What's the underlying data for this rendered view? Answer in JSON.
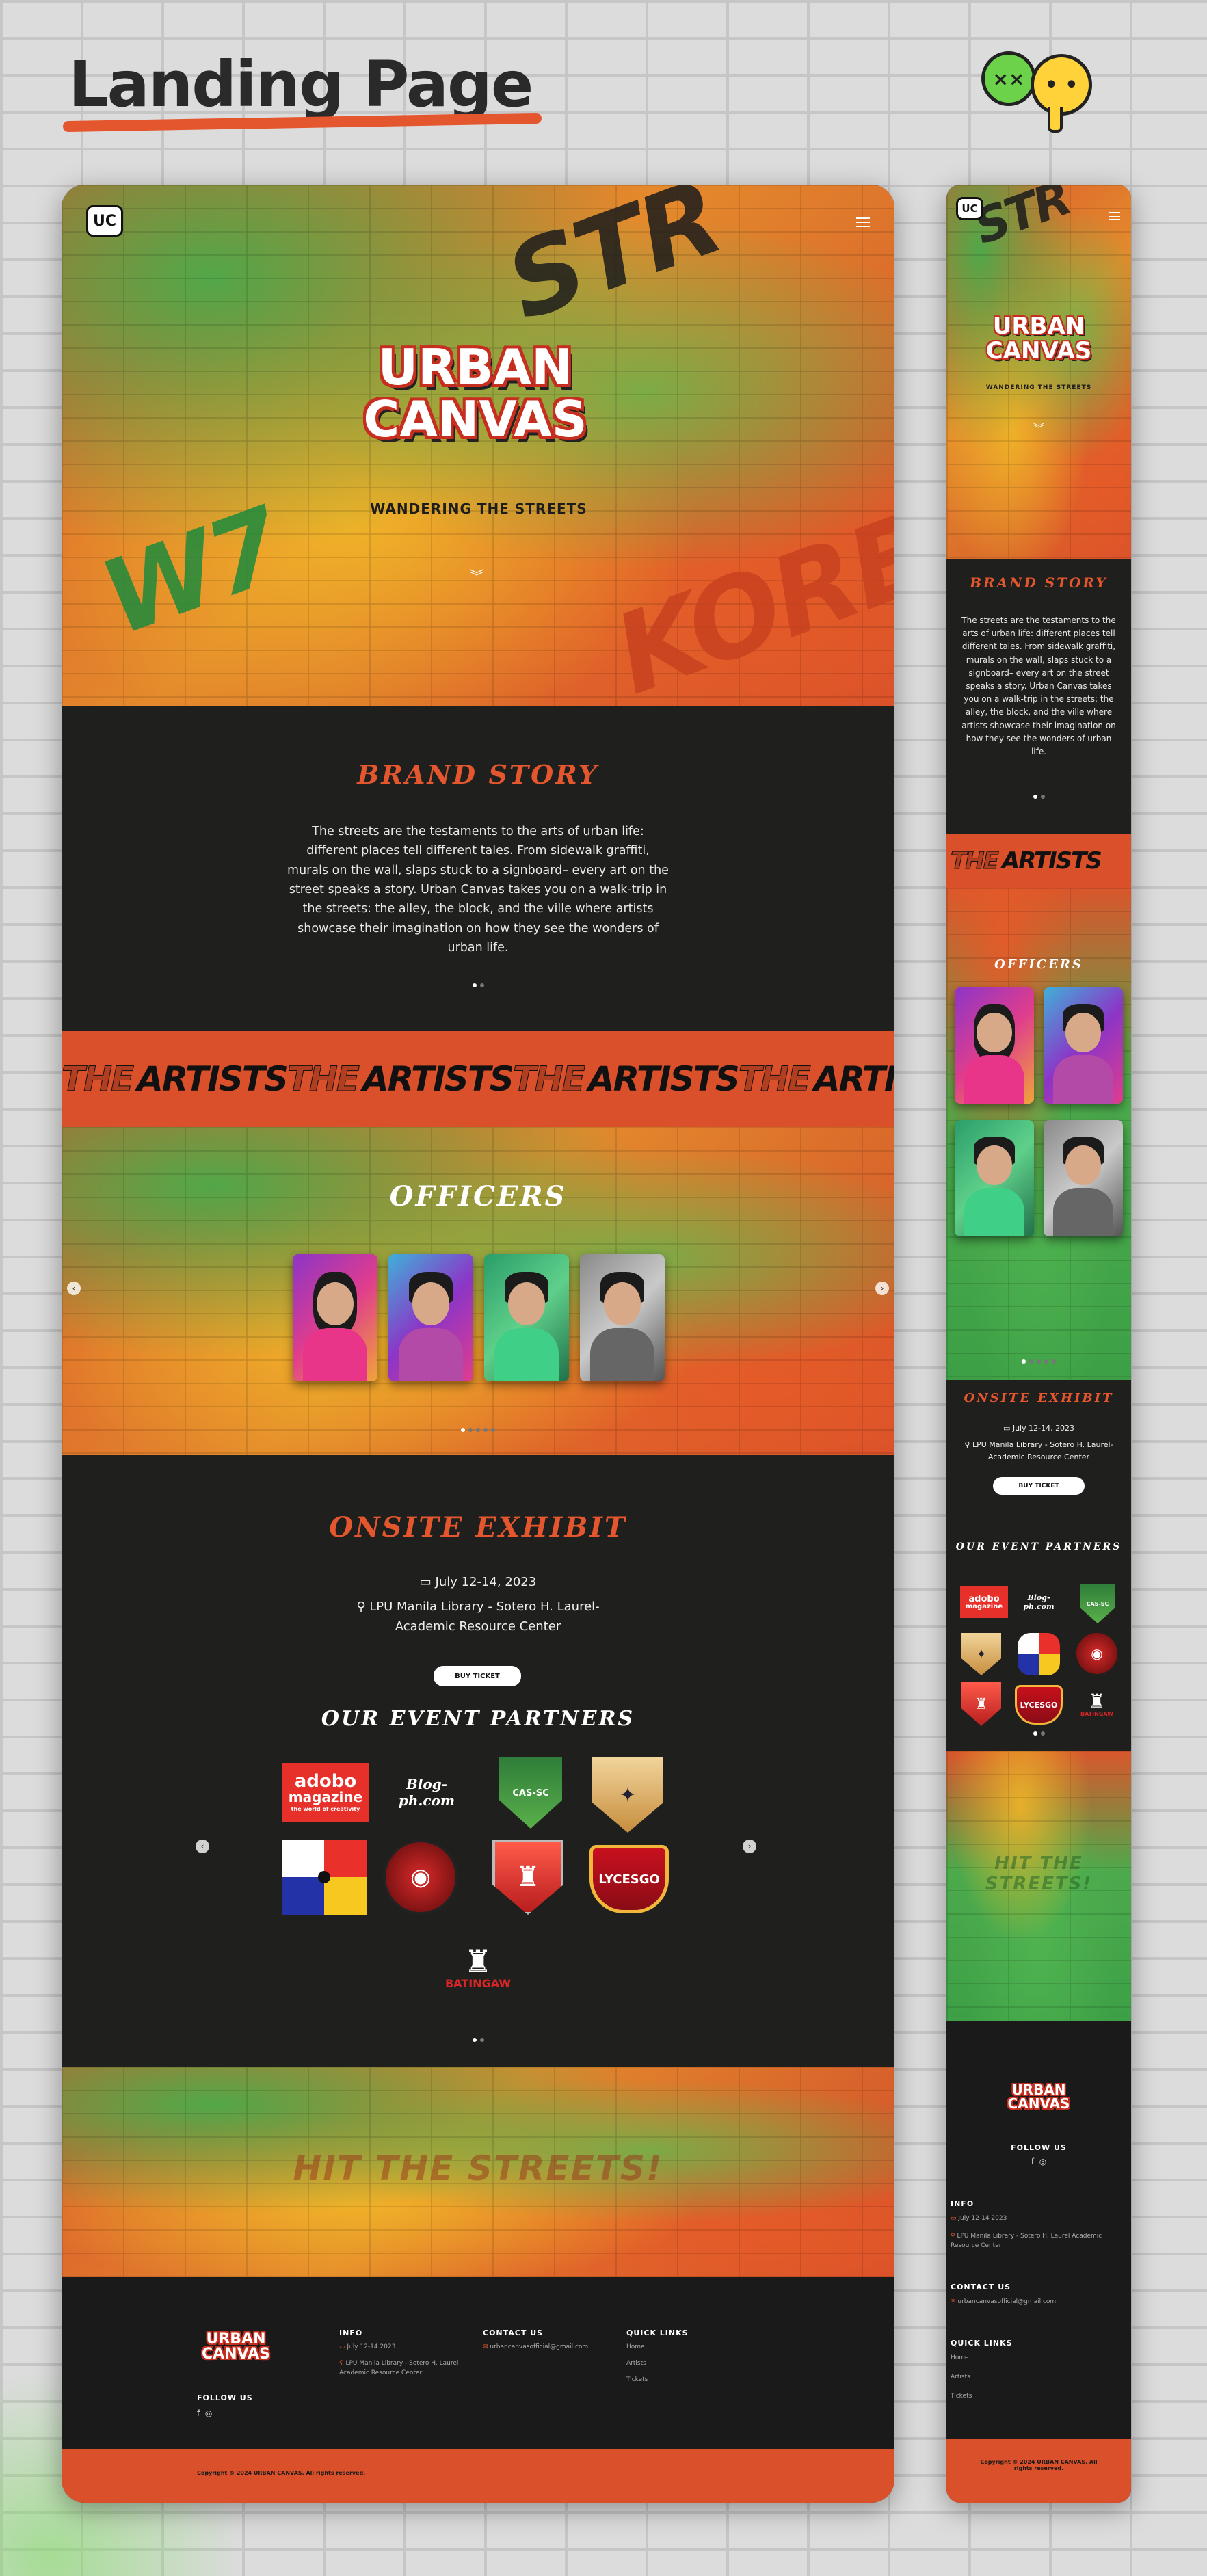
{
  "page": {
    "heading": "Landing Page"
  },
  "brand": {
    "logo_mark": "UC",
    "title_line1": "URBAN",
    "title_line2": "CANVAS",
    "tagline": "WANDERING THE STREETS"
  },
  "hero": {
    "scroll_glyph": "︾"
  },
  "brand_story": {
    "title": "BRAND STORY",
    "text": "The streets are the testaments to the arts of urban life: different places tell different tales. From sidewalk graffiti, murals on the wall, slaps stuck to a signboard– every art on the street speaks a story. Urban Canvas takes you on a walk-trip in the streets: the alley, the block, and the ville where artists showcase their imagination on how they see the wonders of urban life."
  },
  "artists_band": {
    "word_the": "THE",
    "word_artists": "ARTISTS"
  },
  "officers": {
    "title": "OFFICERS",
    "prev": "‹",
    "next": "›"
  },
  "exhibit": {
    "title": "ONSITE EXHIBIT",
    "date": "July 12-14, 2023",
    "venue": "LPU Manila Library - Sotero H. Laurel-Academic Resource Center",
    "venue_line1": "LPU Manila Library - Sotero H. Laurel-",
    "venue_line2": "Academic Resource Center",
    "button": "BUY TICKET",
    "calendar_icon": "calendar-icon",
    "pin_icon": "location-pin-icon"
  },
  "partners": {
    "title": "OUR EVENT PARTNERS",
    "items": [
      {
        "name": "adobo magazine",
        "line1": "adobo",
        "line2": "magazine",
        "line3": "the world of creativity"
      },
      {
        "name": "Blog-ph.com",
        "line1": "Blog-ph.com"
      },
      {
        "name": "CAS-SC",
        "line1": "CAS-SC"
      },
      {
        "name": "Crest",
        "line1": "✦"
      },
      {
        "name": "Pinwheel",
        "line1": ""
      },
      {
        "name": "Camera Club",
        "line1": "◉"
      },
      {
        "name": "Red Shield",
        "line1": "♜"
      },
      {
        "name": "LYCESGO",
        "line1": "LYCESGO"
      },
      {
        "name": "BATINGAW",
        "line1": "BATINGAW"
      }
    ]
  },
  "hit_streets": {
    "text": "HIT THE STREETS!"
  },
  "footer": {
    "follow_us": "FOLLOW US",
    "social_facebook": "f",
    "social_instagram": "◎",
    "info_title": "INFO",
    "info_date": "July 12-14 2023",
    "info_venue": "LPU Manila Library - Sotero H. Laurel Academic Resource Center",
    "contact_title": "CONTACT US",
    "contact_email": "urbancanvasofficial@gmail.com",
    "links_title": "QUICK LINKS",
    "links": [
      "Home",
      "Artists",
      "Tickets"
    ],
    "copyright": "Copyright © 2024 URBAN CANVAS. All rights reserved."
  },
  "colors": {
    "accent": "#e4572e",
    "dark": "#1f1f1d",
    "green": "#4aaa4a",
    "yellow": "#f0b428"
  }
}
